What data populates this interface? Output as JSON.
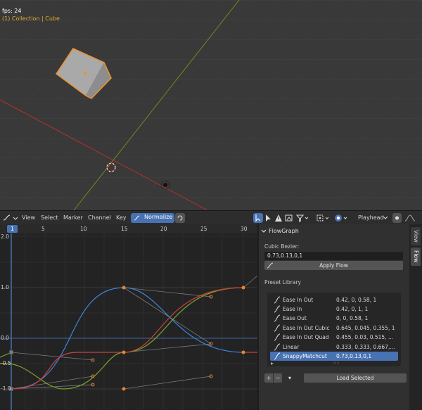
{
  "viewport": {
    "fps_text": "fps: 24",
    "collection_text": "(1) Collection | Cube"
  },
  "header": {
    "menu": [
      "View",
      "Select",
      "Marker",
      "Channel",
      "Key"
    ],
    "normalize_label": "Normalize",
    "playhead_label": "Playhead"
  },
  "ruler": {
    "frames": [
      "5",
      "10",
      "15",
      "20",
      "25",
      "30"
    ],
    "current_frame": "1"
  },
  "graph": {
    "y_labels": [
      "2.0",
      "1.0",
      "0.0",
      "-0.5",
      "-1.0"
    ]
  },
  "panel": {
    "title": "FlowGraph",
    "bezier_label": "Cubic Bezier:",
    "bezier_value": "0.73,0.13,0,1",
    "apply_label": "Apply Flow",
    "library_label": "Preset Library",
    "presets": [
      {
        "name": "Ease In Out",
        "value": "0.42, 0, 0.58, 1"
      },
      {
        "name": "Ease In",
        "value": "0.42, 0, 1, 1"
      },
      {
        "name": "Ease Out",
        "value": "0, 0, 0.58, 1"
      },
      {
        "name": "Ease In Out Cubic",
        "value": "0.645, 0.045, 0.355, 1"
      },
      {
        "name": "Ease In Out Quad",
        "value": "0.455, 0.03, 0.515, ..."
      },
      {
        "name": "Linear",
        "value": "0.333, 0.333, 0.667,..."
      },
      {
        "name": "SnappyMatchcut",
        "value": "0.73,0.13,0,1"
      }
    ],
    "add_label": "+",
    "remove_label": "−",
    "menu_label": "▾",
    "load_label": "Load Selected"
  },
  "tabs": {
    "view": "View",
    "flow": "Flow"
  },
  "colors": {
    "accent": "#4772b3",
    "curve_blue": "#3d86e0",
    "curve_red": "#d04040",
    "curve_green": "#7aa826",
    "keyframe": "#e8852b"
  }
}
